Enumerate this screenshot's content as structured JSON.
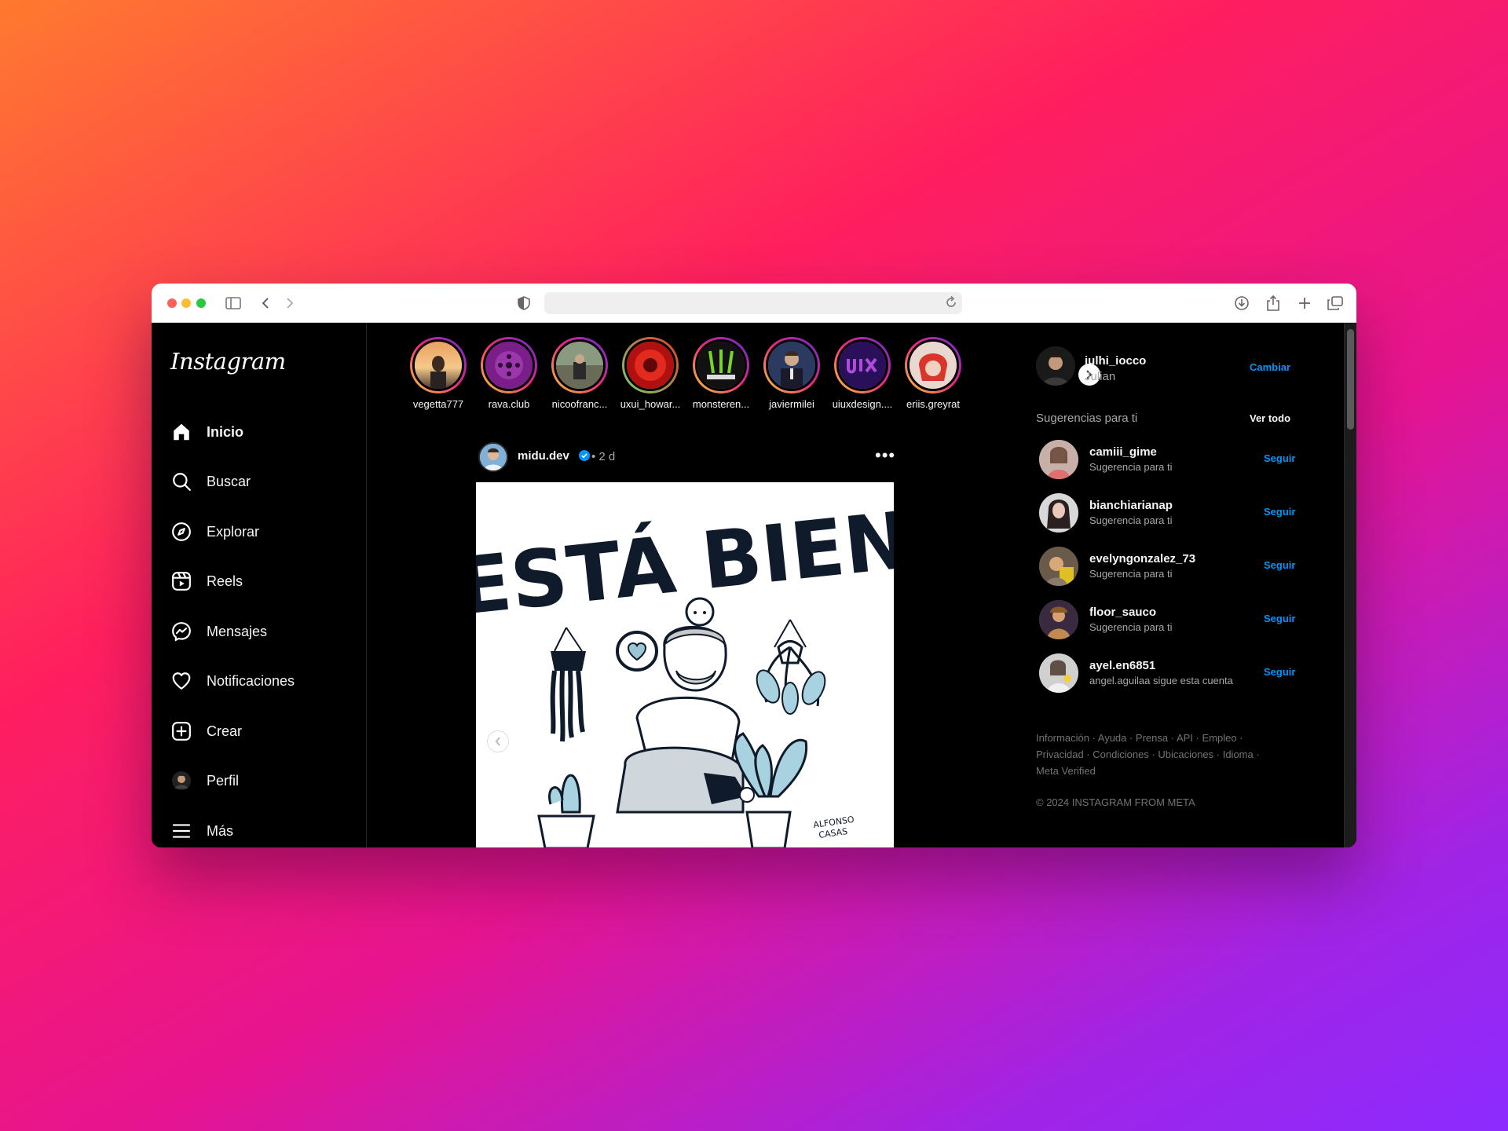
{
  "browser": {
    "address_value": "",
    "icons": [
      "sidebar-toggle-icon",
      "back-icon",
      "forward-icon",
      "shield-icon",
      "reload-icon",
      "download-icon",
      "share-icon",
      "new-tab-icon",
      "tabs-overview-icon"
    ]
  },
  "app": {
    "logo_text": "Instagram"
  },
  "nav": [
    {
      "label": "Inicio",
      "icon": "home-icon",
      "active": true
    },
    {
      "label": "Buscar",
      "icon": "search-icon"
    },
    {
      "label": "Explorar",
      "icon": "compass-icon"
    },
    {
      "label": "Reels",
      "icon": "reels-icon"
    },
    {
      "label": "Mensajes",
      "icon": "messenger-icon"
    },
    {
      "label": "Notificaciones",
      "icon": "heart-icon"
    },
    {
      "label": "Crear",
      "icon": "plus-square-icon"
    },
    {
      "label": "Perfil",
      "icon": "avatar"
    },
    {
      "label": "Más",
      "icon": "menu-icon"
    }
  ],
  "stories": [
    {
      "name": "vegetta777"
    },
    {
      "name": "rava.club"
    },
    {
      "name": "nicoofranc..."
    },
    {
      "name": "uxui_howar..."
    },
    {
      "name": "monsteren..."
    },
    {
      "name": "javiermilei"
    },
    {
      "name": "uiuxdesign...."
    },
    {
      "name": "eriis.greyrat"
    }
  ],
  "post": {
    "username": "midu.dev",
    "time": "• 2 d",
    "more": "•••",
    "image_title": "ESTÁ BIEN",
    "image_signature_1": "ALFONSO",
    "image_signature_2": "CASAS"
  },
  "profile": {
    "username": "julhi_iocco",
    "name": "Julian",
    "switch_label": "Cambiar"
  },
  "suggestions": {
    "title": "Sugerencias para ti",
    "see_all": "Ver todo",
    "items": [
      {
        "username": "camiii_gime",
        "subtitle": "Sugerencia para ti",
        "action": "Seguir"
      },
      {
        "username": "bianchiarianap",
        "subtitle": "Sugerencia para ti",
        "action": "Seguir"
      },
      {
        "username": "evelyngonzalez_73",
        "subtitle": "Sugerencia para ti",
        "action": "Seguir"
      },
      {
        "username": "floor_sauco",
        "subtitle": "Sugerencia para ti",
        "action": "Seguir"
      },
      {
        "username": "ayel.en6851",
        "subtitle": "angel.aguilaa sigue esta cuenta",
        "action": "Seguir"
      }
    ]
  },
  "footer": {
    "links_line_1": "Información · Ayuda · Prensa · API · Empleo ·",
    "links_line_2": "Privacidad · Condiciones · Ubicaciones · Idioma ·",
    "links_line_3": "Meta Verified",
    "copyright": "© 2024 INSTAGRAM FROM META"
  },
  "colors": {
    "accent": "#0095f6",
    "background": "#000000",
    "text": "#f5f5f5",
    "muted": "#a8a8a8"
  }
}
